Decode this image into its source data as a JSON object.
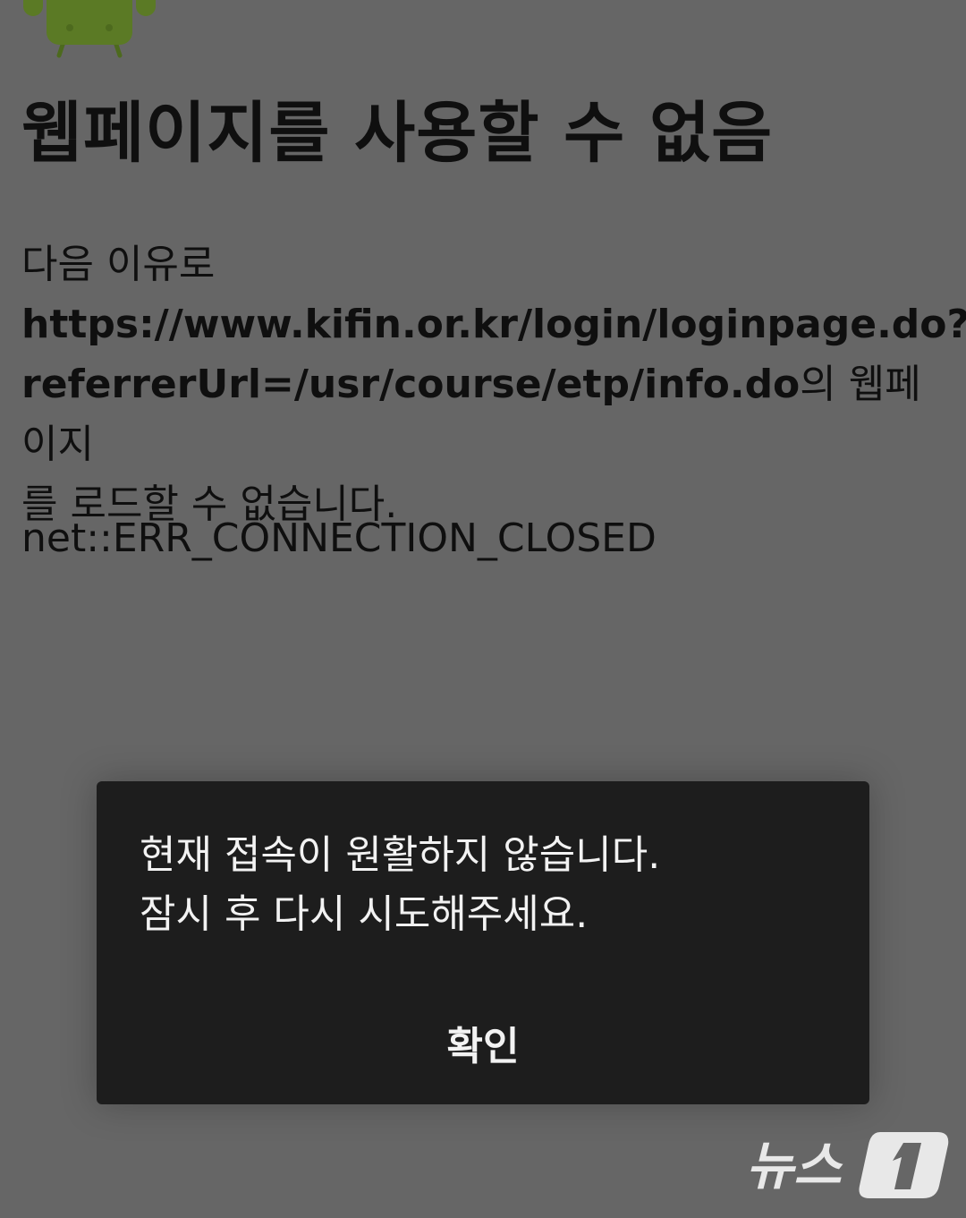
{
  "page": {
    "title": "웹페이지를 사용할 수 없음",
    "reason_prefix": "다음 이유로",
    "url": "https://www.kifin.or.kr/login/loginpage.do?referrerUrl=/usr/course/etp/info.do",
    "reason_suffix": "의 웹페이지를 로드할 수 없습니다.",
    "error_code": "net::ERR_CONNECTION_CLOSED"
  },
  "dialog": {
    "message_line1": "현재 접속이 원활하지 않습니다.",
    "message_line2": "잠시 후 다시 시도해주세요.",
    "ok_label": "확인"
  },
  "watermark": {
    "text": "뉴스1"
  },
  "colors": {
    "background": "#666666",
    "dialog_background": "#1d1d1d",
    "text_dark": "#0f0f0f",
    "text_light": "#f2f2f2",
    "android_green": "#5b7a25"
  },
  "icons": {
    "error_illustration": "android-robot-icon",
    "logo": "news1-logo"
  }
}
